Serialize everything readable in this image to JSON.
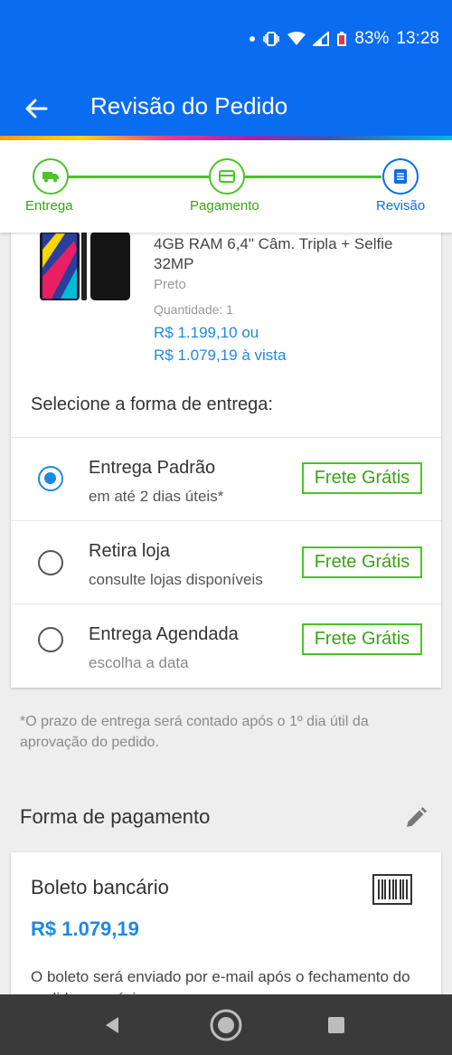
{
  "status_bar": {
    "battery": "83%",
    "time": "13:28"
  },
  "app_bar": {
    "title": "Revisão do Pedido"
  },
  "stepper": {
    "steps": [
      {
        "label": "Entrega",
        "icon": "truck-icon"
      },
      {
        "label": "Pagamento",
        "icon": "card-icon"
      },
      {
        "label": "Revisão",
        "icon": "document-icon"
      }
    ]
  },
  "product": {
    "spec_line1": "4GB RAM 6,4\" Câm. Tripla + Selfie",
    "spec_line2": "32MP",
    "color": "Preto",
    "quantity": "Quantidade:  1",
    "price_installments": "R$ 1.199,10 ou",
    "price_cash": "R$ 1.079,19 à vista"
  },
  "shipping": {
    "title": "Selecione a forma de entrega:",
    "options": [
      {
        "title": "Entrega Padrão",
        "subtitle": "em até 2 dias úteis*",
        "badge": "Frete Grátis",
        "selected": true
      },
      {
        "title": "Retira loja",
        "subtitle": "consulte lojas disponíveis",
        "badge": "Frete Grátis",
        "selected": false
      },
      {
        "title": "Entrega Agendada",
        "subtitle": "escolha a data",
        "badge": "Frete Grátis",
        "selected": false
      }
    ],
    "note": "*O prazo de entrega será contado após o 1º dia útil da aprovação do pedido."
  },
  "payment": {
    "header": "Forma de pagamento",
    "method": "Boleto bancário",
    "amount": "R$ 1.079,19",
    "description": "O boleto será enviado por e-mail após o fechamento do pedido no próximo passo."
  },
  "colors": {
    "primary": "#0a6cf0",
    "accent_blue": "#1e88e5",
    "green": "#4cc326"
  }
}
